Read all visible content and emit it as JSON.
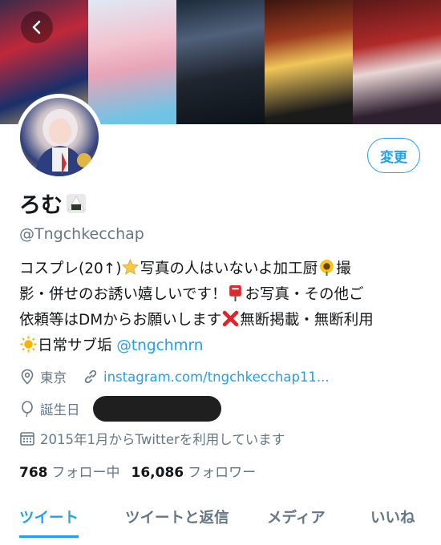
{
  "colors": {
    "accent": "#1da1f2",
    "secondary_text": "#657786",
    "primary_text": "#14171a"
  },
  "header": {
    "back_icon": "chevron-left-icon"
  },
  "profile": {
    "edit_label": "変更",
    "name": "ろむ",
    "name_emoji": "rice-ball-icon",
    "handle": "@Tngchkecchap"
  },
  "bio": {
    "line1a": "コスプレ(20↑)",
    "line1b": "写真の人はいないよ加工厨",
    "line1c": "撮",
    "line2a": "影・併せのお誘い嬉しいです！",
    "line2b": "お写真・その他ご",
    "line3a": "依頼等はDMからお願いします",
    "line3b": "無断掲載・無断利用",
    "line4a": "日常サブ垢 ",
    "line4_link": "@tngchmrn"
  },
  "meta": {
    "location": "東京",
    "website": "instagram.com/tngchkecchap11...",
    "birthday_label": "誕生日",
    "joined": "2015年1月からTwitterを利用しています"
  },
  "stats": {
    "following_count": "768",
    "following_label": "フォロー中",
    "followers_count": "16,086",
    "followers_label": "フォロワー"
  },
  "tabs": [
    {
      "label": "ツイート"
    },
    {
      "label": "ツイートと返信"
    },
    {
      "label": "メディア"
    },
    {
      "label": "いいね"
    }
  ]
}
